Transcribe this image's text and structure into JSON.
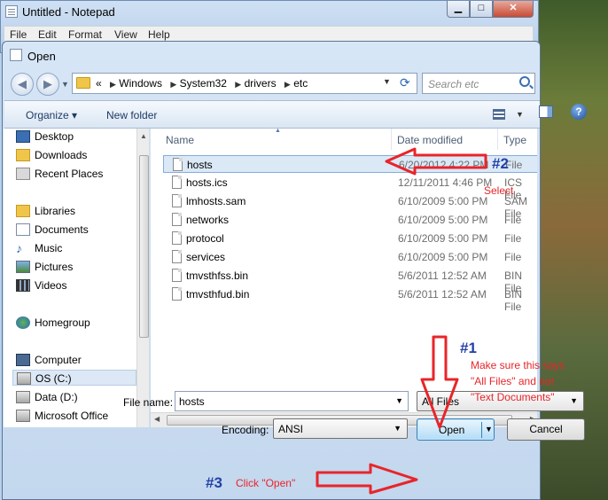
{
  "notepad": {
    "title": "Untitled - Notepad",
    "menu": [
      "File",
      "Edit",
      "Format",
      "View",
      "Help"
    ]
  },
  "dialog": {
    "title": "Open",
    "address": {
      "prefix": "«",
      "crumbs": [
        "Windows",
        "System32",
        "drivers",
        "etc"
      ]
    },
    "search_placeholder": "Search etc",
    "toolbar": {
      "organize_label": "Organize ▾",
      "new_folder_label": "New folder"
    },
    "nav": {
      "items": [
        {
          "label": "Desktop",
          "icon": "desktop-icon"
        },
        {
          "label": "Downloads",
          "icon": "downloads-folder-icon"
        },
        {
          "label": "Recent Places",
          "icon": "recent-places-icon"
        },
        {
          "label": "Libraries",
          "icon": "libraries-icon"
        },
        {
          "label": "Documents",
          "icon": "documents-icon"
        },
        {
          "label": "Music",
          "icon": "music-icon"
        },
        {
          "label": "Pictures",
          "icon": "pictures-icon"
        },
        {
          "label": "Videos",
          "icon": "videos-icon"
        },
        {
          "label": "Homegroup",
          "icon": "homegroup-icon"
        },
        {
          "label": "Computer",
          "icon": "computer-icon"
        },
        {
          "label": "OS (C:)",
          "icon": "drive-icon"
        },
        {
          "label": "Data (D:)",
          "icon": "drive-icon"
        },
        {
          "label": "Microsoft Office",
          "icon": "drive-icon"
        }
      ]
    },
    "columns": {
      "name": "Name",
      "date": "Date modified",
      "type": "Type"
    },
    "files": [
      {
        "name": "hosts",
        "date": "6/20/2012 4:22 PM",
        "type": "File"
      },
      {
        "name": "hosts.ics",
        "date": "12/11/2011 4:46 PM",
        "type": "ICS File"
      },
      {
        "name": "lmhosts.sam",
        "date": "6/10/2009 5:00 PM",
        "type": "SAM File"
      },
      {
        "name": "networks",
        "date": "6/10/2009 5:00 PM",
        "type": "File"
      },
      {
        "name": "protocol",
        "date": "6/10/2009 5:00 PM",
        "type": "File"
      },
      {
        "name": "services",
        "date": "6/10/2009 5:00 PM",
        "type": "File"
      },
      {
        "name": "tmvsthfss.bin",
        "date": "5/6/2011 12:52 AM",
        "type": "BIN File"
      },
      {
        "name": "tmvsthfud.bin",
        "date": "5/6/2011 12:52 AM",
        "type": "BIN File"
      }
    ],
    "filename_label": "File name:",
    "filename_value": "hosts",
    "filetype_value": "All Files",
    "encoding_label": "Encoding:",
    "encoding_value": "ANSI",
    "open_label": "Open",
    "cancel_label": "Cancel"
  },
  "annotations": {
    "step1_num": "#1",
    "step1_text": [
      "Make sure this says",
      "\"All Files\" and not",
      "\"Text Documents\""
    ],
    "step2_num": "#2",
    "step2_text": "Select",
    "step3_num": "#3",
    "step3_text": "Click \"Open\"",
    "color": "#e8252a",
    "num_color": "#2340a8"
  }
}
